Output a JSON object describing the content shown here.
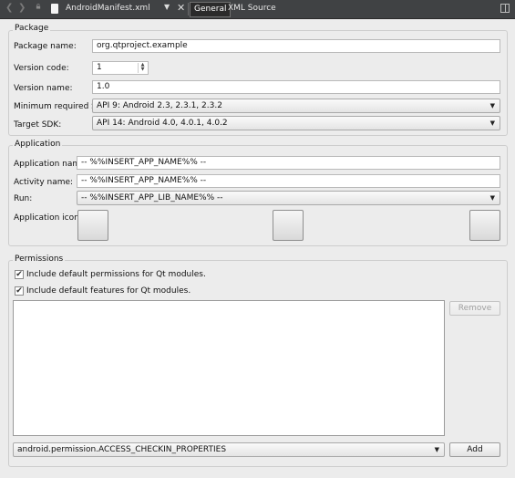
{
  "editor": {
    "file_name": "AndroidManifest.xml",
    "tabs": [
      "General",
      "XML Source"
    ],
    "active_tab": "General",
    "icons": [
      "back-arrow-icon",
      "forward-arrow-icon",
      "lock-icon",
      "file-icon",
      "chevron-down-icon",
      "close-icon",
      "split-view-icon"
    ]
  },
  "package": {
    "section_title": "Package",
    "package_name_label": "Package name:",
    "package_name_value": "org.qtproject.example",
    "version_code_label": "Version code:",
    "version_code_value": "1",
    "version_name_label": "Version name:",
    "version_name_value": "1.0",
    "min_sdk_label": "Minimum required SDK:",
    "min_sdk_value": "API 9: Android 2.3, 2.3.1, 2.3.2",
    "target_sdk_label": "Target SDK:",
    "target_sdk_value": "API 14: Android 4.0, 4.0.1, 4.0.2"
  },
  "application": {
    "section_title": "Application",
    "app_name_label": "Application name:",
    "app_name_value": "-- %%INSERT_APP_NAME%% --",
    "activity_name_label": "Activity name:",
    "activity_name_value": "-- %%INSERT_APP_NAME%% --",
    "run_label": "Run:",
    "run_value": "-- %%INSERT_APP_LIB_NAME%% --",
    "icon_label": "Application icon:"
  },
  "permissions": {
    "section_title": "Permissions",
    "default_permissions_label": "Include default permissions for Qt modules.",
    "default_permissions_checked": true,
    "default_features_label": "Include default features for Qt modules.",
    "default_features_checked": true,
    "remove_label": "Remove",
    "permission_select_value": "android.permission.ACCESS_CHECKIN_PROPERTIES",
    "add_label": "Add"
  }
}
